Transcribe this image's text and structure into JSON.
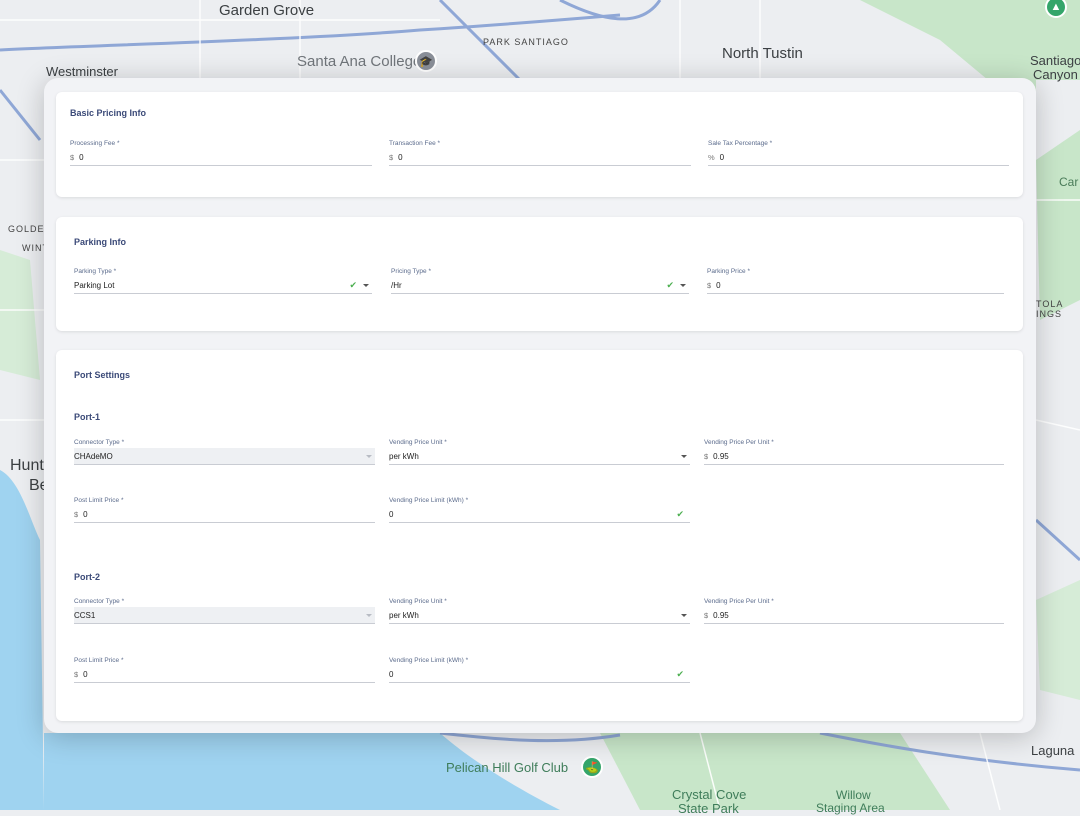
{
  "map": {
    "labels": {
      "garden_grove": "Garden Grove",
      "park_santiago": "PARK SANTIAGO",
      "north_tustin": "North Tustin",
      "santa_ana_college": "Santa Ana College",
      "westminster": "Westminster",
      "santiago": "Santiago",
      "canyon": "Canyon",
      "golden": "GOLDEN",
      "wint": "WINT",
      "hunt": "Hunt",
      "be": "Be",
      "car": "Car",
      "tola": "TOLA",
      "ings": "INGS",
      "pelican_hill": "Pelican Hill Golf Club",
      "crystal_cove": "Crystal Cove",
      "state_park": "State Park",
      "willow": "Willow",
      "staging_area": "Staging Area",
      "laguna": "Laguna"
    },
    "colors": {
      "land": "#eceef1",
      "water": "#9fd3f0",
      "park": "#c8e6c9",
      "road": "#8fa7d6",
      "poi_green": "#34a56a",
      "poi_gray": "#8a8f98"
    }
  },
  "basic_pricing": {
    "title": "Basic Pricing Info",
    "processing_fee": {
      "label": "Processing Fee *",
      "prefix": "$",
      "value": "0"
    },
    "transaction_fee": {
      "label": "Transaction Fee *",
      "prefix": "$",
      "value": "0"
    },
    "sale_tax": {
      "label": "Sale Tax Percentage *",
      "prefix": "%",
      "value": "0"
    }
  },
  "parking": {
    "title": "Parking Info",
    "parking_type": {
      "label": "Parking Type *",
      "value": "Parking Lot"
    },
    "pricing_type": {
      "label": "Pricing Type *",
      "value": "/Hr"
    },
    "parking_price": {
      "label": "Parking Price *",
      "prefix": "$",
      "value": "0"
    }
  },
  "ports": {
    "title": "Port Settings",
    "list": [
      {
        "name": "Port-1",
        "connector_type": {
          "label": "Connector Type *",
          "value": "CHAdeMO"
        },
        "vending_price_unit": {
          "label": "Vending Price Unit *",
          "value": "per kWh"
        },
        "vending_price_per_unit": {
          "label": "Vending Price Per Unit *",
          "prefix": "$",
          "value": "0.95"
        },
        "post_limit_price": {
          "label": "Post Limit Price *",
          "prefix": "$",
          "value": "0"
        },
        "vending_price_limit": {
          "label": "Vending Price Limit (kWh) *",
          "value": "0"
        }
      },
      {
        "name": "Port-2",
        "connector_type": {
          "label": "Connector Type *",
          "value": "CCS1"
        },
        "vending_price_unit": {
          "label": "Vending Price Unit *",
          "value": "per kWh"
        },
        "vending_price_per_unit": {
          "label": "Vending Price Per Unit *",
          "prefix": "$",
          "value": "0.95"
        },
        "post_limit_price": {
          "label": "Post Limit Price *",
          "prefix": "$",
          "value": "0"
        },
        "vending_price_limit": {
          "label": "Vending Price Limit (kWh) *",
          "value": "0"
        }
      }
    ]
  },
  "icons": {
    "check": "✔",
    "caret": "caret-down-icon",
    "poi_school": "🎓",
    "poi_park": "⛳"
  }
}
